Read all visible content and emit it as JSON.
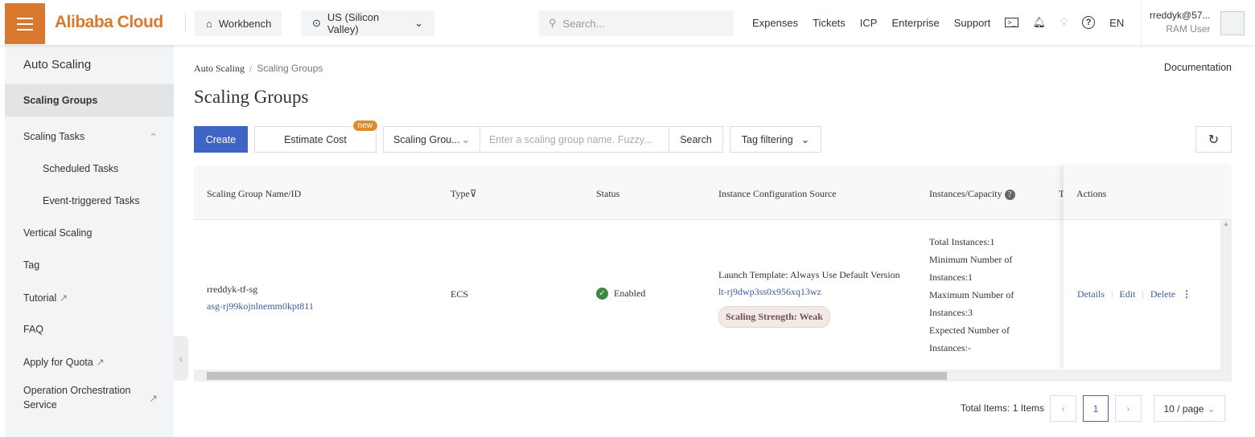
{
  "header": {
    "logo": "Alibaba Cloud",
    "workbench": "Workbench",
    "region": "US (Silicon Valley)",
    "search_placeholder": "Search...",
    "nav": [
      "Expenses",
      "Tickets",
      "ICP",
      "Enterprise",
      "Support"
    ],
    "lang": "EN",
    "user": "rreddyk@57...",
    "role": "RAM User"
  },
  "sidebar": {
    "title": "Auto Scaling",
    "items": [
      {
        "label": "Scaling Groups"
      },
      {
        "label": "Scaling Tasks"
      },
      {
        "label": "Scheduled Tasks"
      },
      {
        "label": "Event-triggered Tasks"
      },
      {
        "label": "Vertical Scaling"
      },
      {
        "label": "Tag"
      },
      {
        "label": "Tutorial"
      },
      {
        "label": "FAQ"
      },
      {
        "label": "Apply for Quota"
      },
      {
        "label": "Operation Orchestration Service"
      }
    ]
  },
  "breadcrumb": {
    "root": "Auto Scaling",
    "sep": "/",
    "current": "Scaling Groups"
  },
  "documentation": "Documentation",
  "page_title": "Scaling Groups",
  "toolbar": {
    "create": "Create",
    "estimate": "Estimate Cost",
    "new_badge": "new",
    "filter_select": "Scaling Grou...",
    "search_placeholder": "Enter a scaling group name. Fuzzy...",
    "search": "Search",
    "tag_filter": "Tag filtering"
  },
  "table": {
    "headers": {
      "name": "Scaling Group Name/ID",
      "type": "Type",
      "status": "Status",
      "source": "Instance Configuration Source",
      "instances": "Instances/Capacity",
      "tag": "T",
      "actions": "Actions"
    },
    "rows": [
      {
        "name": "rreddyk-tf-sg",
        "id": "asg-rj99kojnlnemm0kpt811",
        "type": "ECS",
        "status": "Enabled",
        "source": "Launch Template: Always Use Default Version",
        "template_id": "lt-rj9dwp3ss0x956xq13wz",
        "strength": "Scaling Strength: Weak",
        "inst": [
          "Total Instances:1",
          "Minimum Number of",
          "Instances:1",
          "Maximum Number of",
          "Instances:3",
          "Expected Number of",
          "Instances:-"
        ],
        "actions": [
          "Details",
          "Edit",
          "Delete"
        ]
      }
    ]
  },
  "pagination": {
    "total": "Total Items: 1 Items",
    "page": "1",
    "page_size": "10 / page"
  }
}
